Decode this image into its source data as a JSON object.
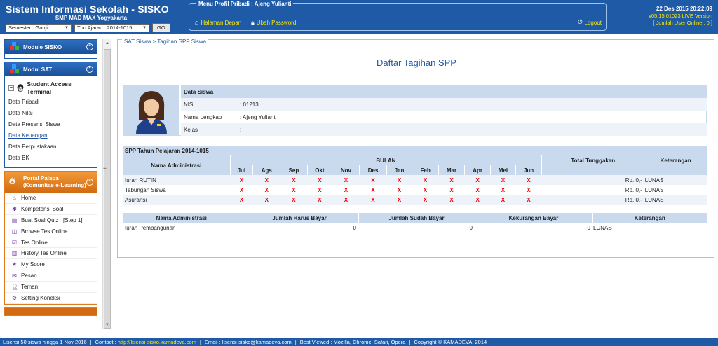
{
  "header": {
    "app_title": "Sistem Informasi Sekolah - SISKO",
    "app_subtitle": "SMP MAD MAX Yogyakarta",
    "semester_value": "Semester : Ganjil",
    "tahun_ajaran_value": "Thn Ajaran : 2014-1015",
    "go_label": "GO",
    "menu_legend": "Menu Profil Pribadi : Ajeng Yulianti",
    "home_link": "Halaman Depan",
    "password_link": "Ubah Password",
    "logout_label": "Logout",
    "datetime": "22 Des 2015 20:22:09",
    "version": "v05.15.01023 LIVE Version",
    "online_users": "[ Jumlah User Online : 0 ]"
  },
  "sidebar": {
    "module_sisko": "Module SISKO",
    "modul_sat": "Modul SAT",
    "student_access": "Student Access Terminal",
    "sat_links": [
      "Data Pribadi",
      "Data Nilai",
      "Data Presensi Siswa",
      "Data Keuangan",
      "Data Perpustakaan",
      "Data BK"
    ],
    "portal_title_1": "Portal Palapa",
    "portal_title_2": "(Komunitas e-Learning)",
    "portal_items": [
      {
        "label": "Home",
        "icon": "home-icon"
      },
      {
        "label": "Kompetensi Soal",
        "icon": "gear-icon"
      },
      {
        "label": "Buat Soal Quiz   [Step 1]",
        "icon": "doc-icon"
      },
      {
        "label": "Browse Tes Online",
        "icon": "browse-icon"
      },
      {
        "label": "Tes Online",
        "icon": "check-icon"
      },
      {
        "label": "History Tes Online",
        "icon": "history-icon"
      },
      {
        "label": "My Score",
        "icon": "star-icon"
      },
      {
        "label": "Pesan",
        "icon": "mail-icon"
      },
      {
        "label": "Teman",
        "icon": "user-icon"
      },
      {
        "label": "Setting Koneksi",
        "icon": "settings-icon"
      }
    ]
  },
  "main": {
    "breadcrumb": "SAT Siswa > Tagihan SPP Siswa",
    "page_title": "Daftar Tagihan SPP",
    "data_siswa_header": "Data Siswa",
    "fields": [
      {
        "label": "NIS",
        "value": ": 01213"
      },
      {
        "label": "Nama Lengkap",
        "value": ": Ajeng Yulianti"
      },
      {
        "label": "Kelas",
        "value": ":"
      }
    ],
    "spp_title": "SPP Tahun Pelajaran 2014-1015",
    "col_nama": "Nama Administrasi",
    "col_bulan": "BULAN",
    "col_total": "Total Tunggakan",
    "col_ket": "Keterangan",
    "months": [
      "Jul",
      "Ags",
      "Sep",
      "Okt",
      "Nov",
      "Des",
      "Jan",
      "Feb",
      "Mar",
      "Apr",
      "Mei",
      "Jun"
    ],
    "mark": "X",
    "rows": [
      {
        "name": "Iuran RUTIN",
        "total": "Rp. 0,-",
        "ket": "LUNAS"
      },
      {
        "name": "Tabungan Siswa",
        "total": "Rp. 0,-",
        "ket": "LUNAS"
      },
      {
        "name": "Asuransi",
        "total": "Rp. 0,-",
        "ket": "LUNAS"
      }
    ],
    "col2_nama": "Nama Administrasi",
    "col2_harus": "Jumlah Harus Bayar",
    "col2_sudah": "Jumlah Sudah Bayar",
    "col2_kurang": "Kekurangan Bayar",
    "col2_ket": "Keterangan",
    "row2": {
      "name": "Iuran Pembangunan",
      "harus": "0",
      "sudah": "0",
      "kurang": "0",
      "ket": "LUNAS"
    }
  },
  "footer": {
    "license": "Lisensi 50 siswa hingga 1 Nov 2016",
    "contact_label": "Contact :",
    "contact_url": "http://lisensi-sisko.kamadeva.com",
    "email": "Email : lisensi-sisko@kamadeva.com",
    "best_viewed": "Best Viewed : Mozilla, Chrome, Safari, Opera",
    "copyright": "Copyright © KAMADEVA, 2014"
  },
  "colors": {
    "primary": "#1f5aa6",
    "accent_yellow": "#ffea00",
    "portal_orange": "#e07a1a",
    "table_header": "#c9d9ee",
    "mark_red": "#e00000"
  }
}
